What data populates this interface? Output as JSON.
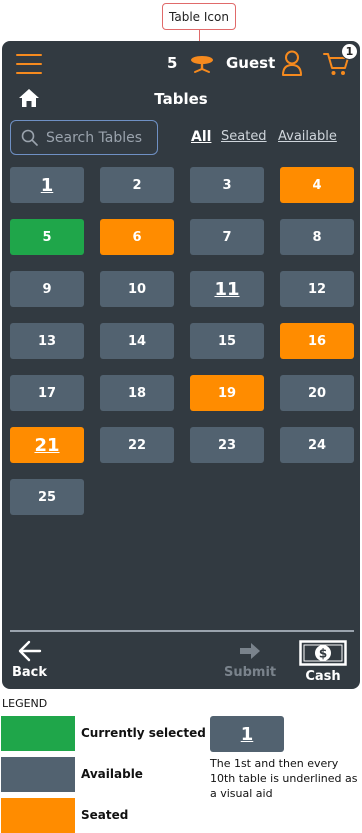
{
  "callout": {
    "label": "Table Icon"
  },
  "header": {
    "table_number": "5",
    "guest_label": "Guest",
    "cart_count": "1"
  },
  "nav": {
    "title": "Tables"
  },
  "search": {
    "placeholder": "Search Tables"
  },
  "filters": {
    "all": "All",
    "seated": "Seated",
    "available": "Available",
    "active": "All"
  },
  "tables": [
    {
      "label": "1",
      "status": "available",
      "aid": true
    },
    {
      "label": "2",
      "status": "available",
      "aid": false
    },
    {
      "label": "3",
      "status": "available",
      "aid": false
    },
    {
      "label": "4",
      "status": "seated",
      "aid": false
    },
    {
      "label": "5",
      "status": "selected",
      "aid": false
    },
    {
      "label": "6",
      "status": "seated",
      "aid": false
    },
    {
      "label": "7",
      "status": "available",
      "aid": false
    },
    {
      "label": "8",
      "status": "available",
      "aid": false
    },
    {
      "label": "9",
      "status": "available",
      "aid": false
    },
    {
      "label": "10",
      "status": "available",
      "aid": false
    },
    {
      "label": "11",
      "status": "available",
      "aid": true
    },
    {
      "label": "12",
      "status": "available",
      "aid": false
    },
    {
      "label": "13",
      "status": "available",
      "aid": false
    },
    {
      "label": "14",
      "status": "available",
      "aid": false
    },
    {
      "label": "15",
      "status": "available",
      "aid": false
    },
    {
      "label": "16",
      "status": "seated",
      "aid": false
    },
    {
      "label": "17",
      "status": "available",
      "aid": false
    },
    {
      "label": "18",
      "status": "available",
      "aid": false
    },
    {
      "label": "19",
      "status": "seated",
      "aid": false
    },
    {
      "label": "20",
      "status": "available",
      "aid": false
    },
    {
      "label": "21",
      "status": "seated",
      "aid": true
    },
    {
      "label": "22",
      "status": "available",
      "aid": false
    },
    {
      "label": "23",
      "status": "available",
      "aid": false
    },
    {
      "label": "24",
      "status": "available",
      "aid": false
    },
    {
      "label": "25",
      "status": "available",
      "aid": false
    }
  ],
  "footer": {
    "back": "Back",
    "submit": "Submit",
    "cash": "Cash"
  },
  "legend": {
    "title": "LEGEND",
    "selected": "Currently selected",
    "available": "Available",
    "seated": "Seated",
    "aid_example": "1",
    "aid_text": "The 1st and then every 10th table is underlined as a visual aid"
  },
  "colors": {
    "background": "#323a41",
    "accent": "#f68a1e",
    "available": "#526270",
    "seated": "#ff8c00",
    "selected": "#1fa64a",
    "icons": [
      "menu-icon",
      "table-icon",
      "user-icon",
      "cart-icon",
      "home-icon",
      "search-icon",
      "arrow-left-icon",
      "arrow-right-icon",
      "cash-icon"
    ]
  }
}
